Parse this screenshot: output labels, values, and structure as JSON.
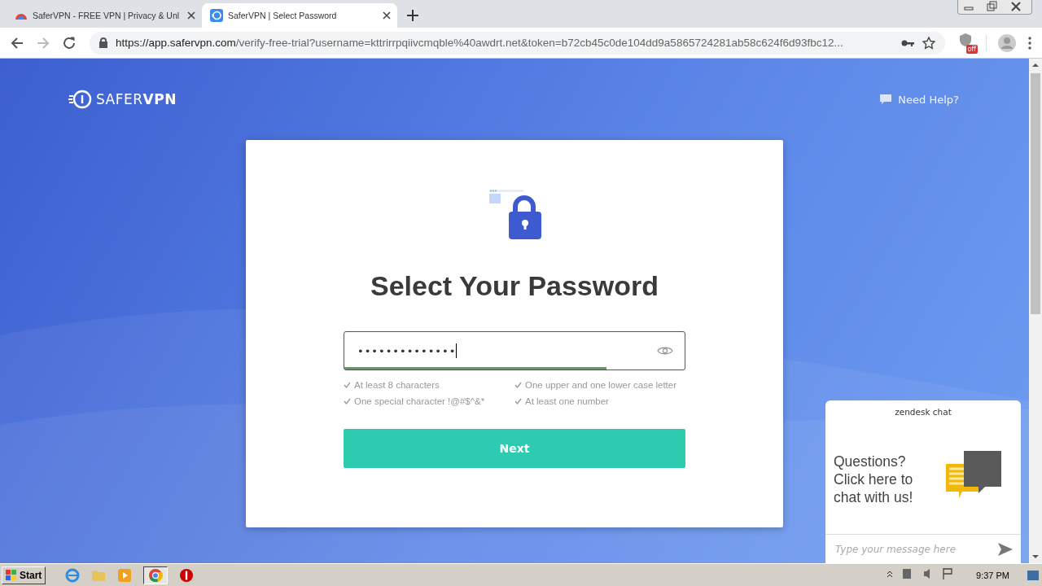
{
  "browser": {
    "tabs": [
      {
        "title": "SaferVPN - FREE VPN | Privacy & Unl",
        "selected": false
      },
      {
        "title": "SaferVPN | Select Password",
        "selected": true
      }
    ],
    "address": {
      "origin": "https://app.safervpn.com",
      "path": "/verify-free-trial?username=kttrirrpqiivcmqble%40awdrt.net&token=b72cb45c0de104dd9a5865724281ab58c624f6d93fbc12..."
    },
    "extension_badge": "off"
  },
  "page": {
    "logo": "SAFER**VPN**",
    "help_link": "Need Help?",
    "heading": "Select Your Password",
    "password": {
      "value": "••••••••••••••",
      "strength": {
        "level": 0.77
      }
    },
    "requirements": [
      {
        "text": "At least 8 characters",
        "met": true
      },
      {
        "text": "One upper and one lower case letter",
        "met": true
      },
      {
        "text": "One special character !@#$^&*",
        "met": true
      },
      {
        "text": "At least one number",
        "met": true
      }
    ],
    "next_button": "Next"
  },
  "chat_widget": {
    "brand": "zendesk chat",
    "prompt": "Questions? Click here to chat with us!",
    "input": {
      "placeholder": "Type your message here"
    }
  },
  "taskbar": {
    "start": "Start",
    "clock": "9:37 PM"
  }
}
